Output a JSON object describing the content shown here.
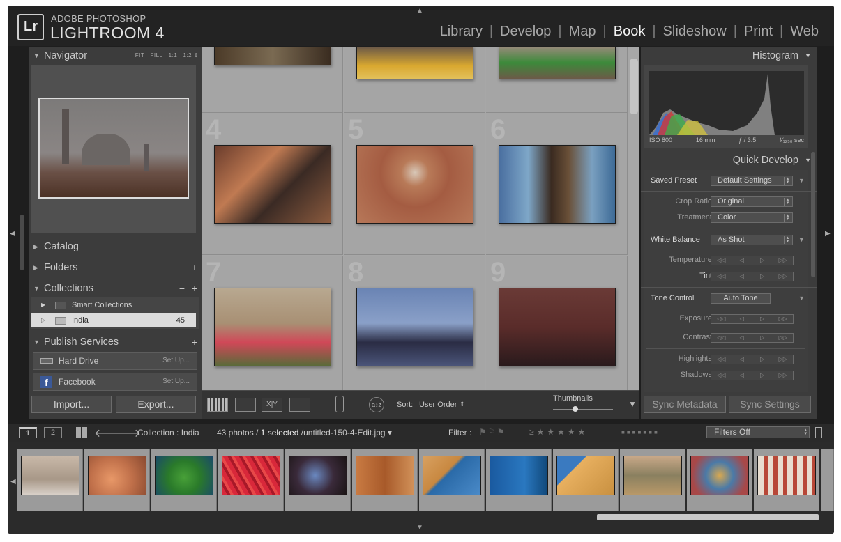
{
  "app": {
    "brand_top": "ADOBE PHOTOSHOP",
    "brand_main": "LIGHTROOM 4",
    "logo": "Lr"
  },
  "modules": [
    {
      "label": "Library",
      "active": false
    },
    {
      "label": "Develop",
      "active": false
    },
    {
      "label": "Map",
      "active": false
    },
    {
      "label": "Book",
      "active": true
    },
    {
      "label": "Slideshow",
      "active": false
    },
    {
      "label": "Print",
      "active": false
    },
    {
      "label": "Web",
      "active": false
    }
  ],
  "navigator": {
    "title": "Navigator",
    "options": [
      "FIT",
      "FILL",
      "1:1",
      "1:2"
    ]
  },
  "left_panels": {
    "catalog": "Catalog",
    "folders": "Folders",
    "collections": "Collections",
    "smart_collections": "Smart Collections",
    "collection_name": "India",
    "collection_count": "45",
    "publish": "Publish Services",
    "hard_drive": "Hard Drive",
    "facebook": "Facebook",
    "setup": "Set Up...",
    "import": "Import...",
    "export": "Export..."
  },
  "grid": {
    "cell_numbers": [
      "4",
      "5",
      "6",
      "7",
      "8",
      "9"
    ]
  },
  "toolbar": {
    "sort_label": "Sort:",
    "sort_value": "User Order",
    "thumbnails_label": "Thumbnails"
  },
  "histogram": {
    "title": "Histogram",
    "iso": "ISO 800",
    "focal": "16 mm",
    "aperture": "ƒ / 3.5",
    "shutter": "¹⁄₁₂₅₀ sec"
  },
  "quick_develop": {
    "title": "Quick Develop",
    "saved_preset_label": "Saved Preset",
    "saved_preset_value": "Default Settings",
    "crop_ratio_label": "Crop Ratio",
    "crop_ratio_value": "Original",
    "treatment_label": "Treatment",
    "treatment_value": "Color",
    "white_balance_label": "White Balance",
    "white_balance_value": "As Shot",
    "temperature_label": "Temperature",
    "tint_label": "Tint",
    "tone_control_label": "Tone Control",
    "auto_tone": "Auto Tone",
    "exposure_label": "Exposure",
    "contrast_label": "Contrast",
    "highlights_label": "Highlights",
    "shadows_label": "Shadows"
  },
  "sync": {
    "metadata": "Sync Metadata",
    "settings": "Sync Settings"
  },
  "filmbar": {
    "view1": "1",
    "view2": "2",
    "collection": "Collection : India",
    "photos": "43 photos /",
    "selected": "1 selected",
    "filename": "/untitled-150-4-Edit.jpg",
    "filter_label": "Filter :",
    "filter_value": "Filters Off"
  },
  "colors": {
    "accent": "#e6e6e6",
    "grid_bg": "#a7a7a7",
    "panel_bg": "#3b3b3b"
  }
}
